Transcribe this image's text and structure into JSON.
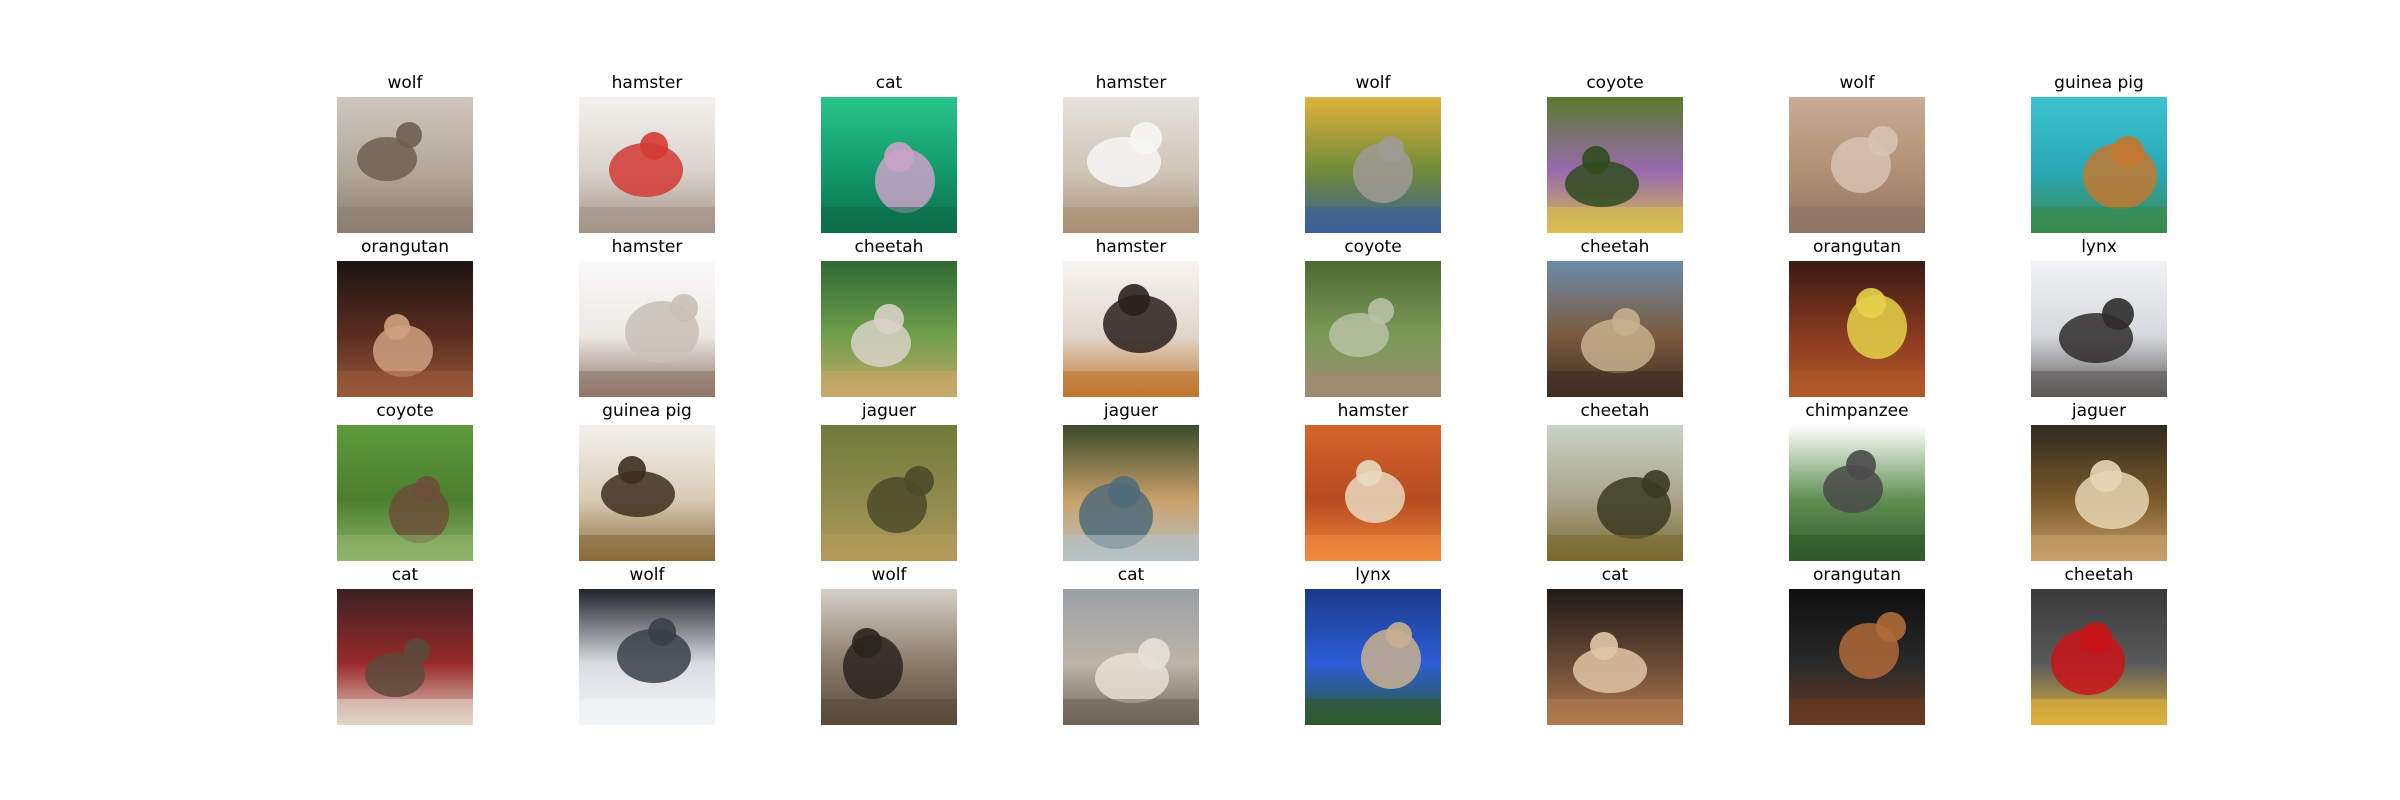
{
  "figure": {
    "rows": [
      [
        {
          "label": "wolf",
          "scene": [
            "#cfc6bd",
            "#b3a79a",
            "#8c7e71",
            "#6d5f52"
          ]
        },
        {
          "label": "hamster",
          "scene": [
            "#f4f1ee",
            "#d9d2cc",
            "#a39387",
            "#d43a34"
          ]
        },
        {
          "label": "cat",
          "scene": [
            "#28c48a",
            "#129a6a",
            "#0d6d4a",
            "#c9a3c8"
          ]
        },
        {
          "label": "hamster",
          "scene": [
            "#e6e2dc",
            "#cfc5b8",
            "#a98f73",
            "#f6f6f4"
          ]
        },
        {
          "label": "wolf",
          "scene": [
            "#e0b23b",
            "#6f8a3a",
            "#3b5f9a",
            "#9f9a96"
          ]
        },
        {
          "label": "coyote",
          "scene": [
            "#5b7a2f",
            "#9a6ab0",
            "#d8c04d",
            "#2f4b1e"
          ]
        },
        {
          "label": "wolf",
          "scene": [
            "#c7ab96",
            "#b08f74",
            "#8f7565",
            "#d7c2b0"
          ]
        },
        {
          "label": "guinea pig",
          "scene": [
            "#3cc3cf",
            "#2aa7b6",
            "#3b8a4c",
            "#c2772f"
          ]
        }
      ],
      [
        {
          "label": "orangutan",
          "scene": [
            "#1b1413",
            "#5b2d1f",
            "#9a5a3a",
            "#d0a080"
          ]
        },
        {
          "label": "hamster",
          "scene": [
            "#fafafa",
            "#ece8e4",
            "#8e7567",
            "#c9bfb6"
          ]
        },
        {
          "label": "cheetah",
          "scene": [
            "#2f6a35",
            "#6e9f4a",
            "#c8a86a",
            "#d8d2c8"
          ]
        },
        {
          "label": "hamster",
          "scene": [
            "#f7f4f1",
            "#e1d6cc",
            "#c0762d",
            "#2a201c"
          ]
        },
        {
          "label": "coyote",
          "scene": [
            "#4c6a33",
            "#7a9a57",
            "#a08b73",
            "#b7c2a5"
          ]
        },
        {
          "label": "cheetah",
          "scene": [
            "#6c8ba8",
            "#7a5a3f",
            "#3f2e22",
            "#c7b08d"
          ]
        },
        {
          "label": "orangutan",
          "scene": [
            "#3a1a14",
            "#8a3a20",
            "#b35a2a",
            "#e4d24a"
          ]
        },
        {
          "label": "lynx",
          "scene": [
            "#f1f2f4",
            "#d5d8dc",
            "#5d5a58",
            "#2e2c2b"
          ]
        }
      ],
      [
        {
          "label": "coyote",
          "scene": [
            "#5e9a3c",
            "#4b7f2e",
            "#8fb56a",
            "#6b4f3a"
          ]
        },
        {
          "label": "guinea pig",
          "scene": [
            "#f3f1ee",
            "#d8cbb4",
            "#8a6b3a",
            "#3d2f1e"
          ]
        },
        {
          "label": "jaguer",
          "scene": [
            "#6f7a3a",
            "#8e8b4c",
            "#b39a5b",
            "#4b4a2a"
          ]
        },
        {
          "label": "jaguer",
          "scene": [
            "#3a4a2a",
            "#c9a06a",
            "#b7c2c6",
            "#4f6b7a"
          ]
        },
        {
          "label": "hamster",
          "scene": [
            "#d5642e",
            "#b54b1f",
            "#f08a3e",
            "#e9d9c0"
          ]
        },
        {
          "label": "cheetah",
          "scene": [
            "#c8d2c6",
            "#a9a38a",
            "#7a6a2c",
            "#3a3a22"
          ]
        },
        {
          "label": "chimpanzee",
          "scene": [
            "#ffffff",
            "#5f8f52",
            "#2f5a2a",
            "#4a4a4a"
          ]
        },
        {
          "label": "jaguer",
          "scene": [
            "#2f2a1f",
            "#7a5a2a",
            "#c9a06a",
            "#e7d6b4"
          ]
        }
      ],
      [
        {
          "label": "cat",
          "scene": [
            "#3a2222",
            "#9a2a2a",
            "#e1d6c8",
            "#5a4a3a"
          ]
        },
        {
          "label": "wolf",
          "scene": [
            "#20242a",
            "#d9dde2",
            "#f3f5f7",
            "#3a3f46"
          ]
        },
        {
          "label": "wolf",
          "scene": [
            "#d5d0c8",
            "#8a7a68",
            "#5a4a3a",
            "#2a241f"
          ]
        },
        {
          "label": "cat",
          "scene": [
            "#9aa0a6",
            "#bdb4a8",
            "#6e6558",
            "#e6e0d6"
          ]
        },
        {
          "label": "lynx",
          "scene": [
            "#1c3a8a",
            "#2b5ed6",
            "#2f5a2a",
            "#c9b08f"
          ]
        },
        {
          "label": "cat",
          "scene": [
            "#1f1a18",
            "#6a4a35",
            "#b07a50",
            "#e0c6a6"
          ]
        },
        {
          "label": "orangutan",
          "scene": [
            "#0f0f0f",
            "#2a2a2a",
            "#6a3a22",
            "#b06a3a"
          ]
        },
        {
          "label": "cheetah",
          "scene": [
            "#3a3a3a",
            "#5a5a5a",
            "#e0b23b",
            "#c9141a"
          ]
        }
      ]
    ]
  }
}
